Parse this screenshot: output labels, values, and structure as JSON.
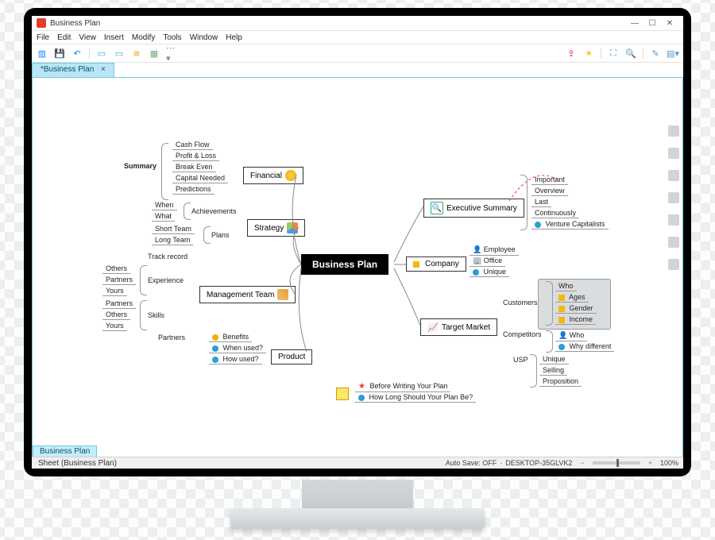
{
  "title": "Business Plan",
  "menu": [
    "File",
    "Edit",
    "View",
    "Insert",
    "Modify",
    "Tools",
    "Window",
    "Help"
  ],
  "tab": "*Business Plan",
  "sheet_tab": "Business Plan",
  "sheet_label": "Sheet (Business Plan)",
  "status": {
    "autosave": "Auto Save: OFF",
    "host": "DESKTOP-35GLVK2",
    "zoom": "100%"
  },
  "central": "Business Plan",
  "nodes": {
    "financial": "Financial",
    "strategy": "Strategy",
    "mgmt": "Management Team",
    "product": "Product",
    "exec": "Executive Summary",
    "company": "Company",
    "target": "Target Market"
  },
  "summary_label": "Summary",
  "financial_items": [
    "Cash Flow",
    "Profit & Loss",
    "Break Even",
    "Capital Needed",
    "Predictions"
  ],
  "strategy_ach": "Achievements",
  "strategy_plans": "Plans",
  "strategy_ach_items": [
    "When",
    "What"
  ],
  "strategy_plan_items": [
    "Short Team",
    "Long Team"
  ],
  "mgmt_groups": [
    "Track record",
    "Experience",
    "Skills",
    "Partners"
  ],
  "mgmt_exp": [
    "Others",
    "Partners",
    "Yours"
  ],
  "mgmt_skills": [
    "Partners",
    "Others",
    "Yours"
  ],
  "product_items": [
    "Benefits",
    "When used?",
    "How used?"
  ],
  "exec_items": [
    "Important",
    "Overview",
    "Last",
    "Continuously",
    "Venture Capitalists"
  ],
  "company_items": [
    "Employee",
    "Office",
    "Unique"
  ],
  "target_groups": [
    "Customers",
    "Competitors",
    "USP"
  ],
  "customers_items": [
    "Who",
    "Ages",
    "Gender",
    "Income"
  ],
  "competitors_items": [
    "Who",
    "Why different"
  ],
  "usp_items": [
    "Unique",
    "Selling",
    "Proposition"
  ],
  "footer_notes": [
    "Before Writing Your Plan",
    "How Long Should Your Plan Be?"
  ]
}
